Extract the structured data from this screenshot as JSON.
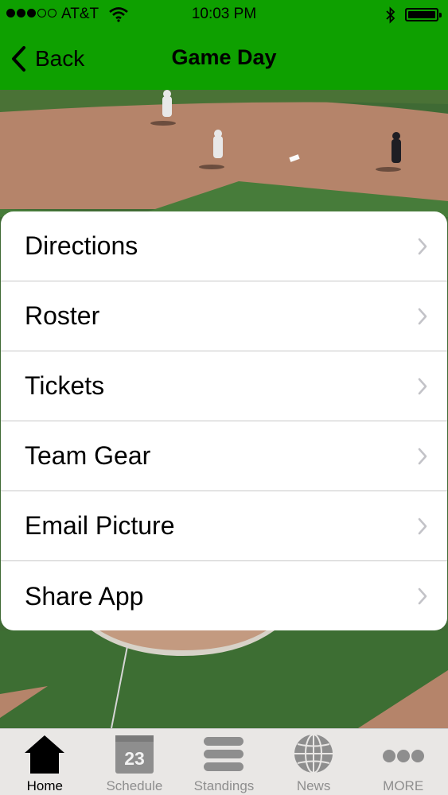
{
  "status_bar": {
    "carrier": "AT&T",
    "time": "10:03 PM"
  },
  "nav": {
    "back_label": "Back",
    "title": "Game Day"
  },
  "menu": {
    "items": [
      {
        "label": "Directions"
      },
      {
        "label": "Roster"
      },
      {
        "label": "Tickets"
      },
      {
        "label": "Team Gear"
      },
      {
        "label": "Email Picture"
      },
      {
        "label": "Share App"
      }
    ]
  },
  "tabbar": {
    "tabs": [
      {
        "label": "Home",
        "icon": "home-icon",
        "active": true
      },
      {
        "label": "Schedule",
        "icon": "calendar-icon",
        "badge": "23"
      },
      {
        "label": "Standings",
        "icon": "standings-icon"
      },
      {
        "label": "News",
        "icon": "globe-icon"
      },
      {
        "label": "MORE",
        "icon": "more-icon"
      }
    ]
  },
  "colors": {
    "nav_bar": "#0ea000",
    "tab_bar": "#e9e7e5",
    "tab_inactive": "#8e8e8e"
  }
}
